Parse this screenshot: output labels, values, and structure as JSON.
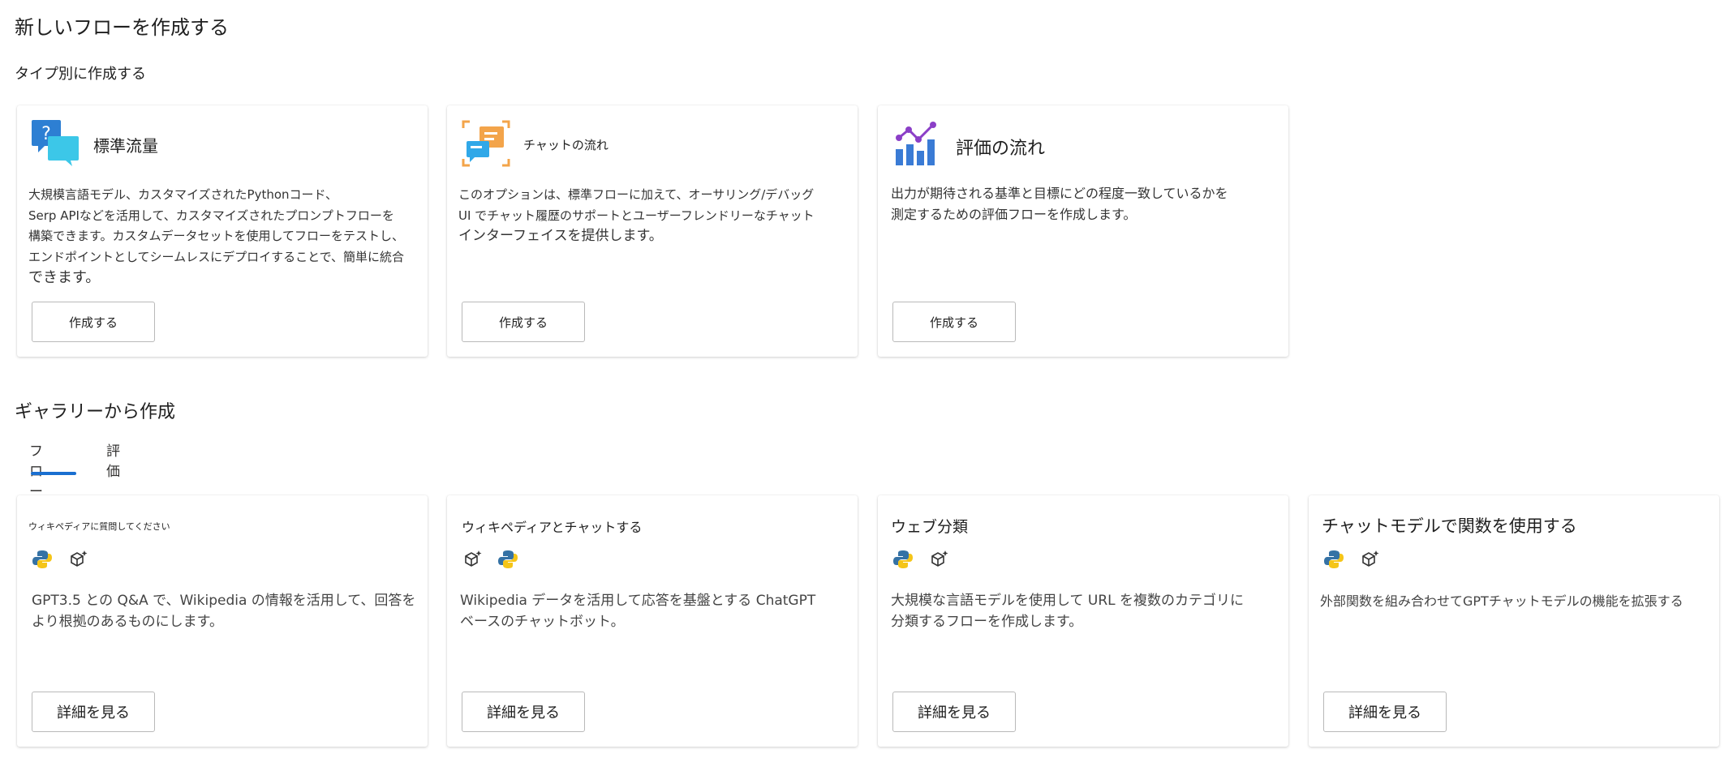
{
  "page": {
    "title": "新しいフローを作成する",
    "by_type_heading": "タイプ別に作成する",
    "gallery_heading": "ギャラリーから作成"
  },
  "type_cards": [
    {
      "title": "標準流量",
      "icon": "chat-question-icon",
      "desc_lines": [
        "大規模言語モデル、カスタマイズされたPythonコード、",
        " Serp APIなどを活用して、カスタマイズされたプロンプトフローを",
        "構築できます。カスタムデータセットを使用してフローをテストし、",
        "エンドポイントとしてシームレスにデプロイすることで、簡単に統合",
        "できます。"
      ],
      "button": "作成する"
    },
    {
      "title": "チャットの流れ",
      "icon": "chat-flow-icon",
      "desc_lines": [
        "このオプションは、標準フローに加えて、オーサリング/デバッグ",
        "UI でチャット履歴のサポートとユーザーフレンドリーなチャット",
        "インターフェイスを提供します。"
      ],
      "button": "作成する"
    },
    {
      "title": "評価の流れ",
      "icon": "evaluation-chart-icon",
      "desc_lines": [
        "出力が期待される基準と目標にどの程度一致しているかを",
        "測定するための評価フローを作成します。"
      ],
      "button": "作成する"
    }
  ],
  "tabs": [
    {
      "label": "フロー",
      "selected": true
    },
    {
      "label": "評価",
      "selected": false
    }
  ],
  "gallery_cards": [
    {
      "title": "ウィキペディアに質問してください",
      "chips": [
        "python-icon",
        "openai-icon"
      ],
      "desc_lines": [
        "GPT3.5 との Q&A で、Wikipedia の情報を活用して、回答を",
        "より根拠のあるものにします。"
      ],
      "button": "詳細を見る"
    },
    {
      "title": "ウィキペディアとチャットする",
      "chips": [
        "openai-icon",
        "python-icon"
      ],
      "desc_lines": [
        "Wikipedia データを活用して応答を基盤とする ChatGPT",
        "ベースのチャットボット。"
      ],
      "button": "詳細を見る"
    },
    {
      "title": "ウェブ分類",
      "chips": [
        "python-icon",
        "openai-icon"
      ],
      "desc_lines": [
        "大規模な言語モデルを使用して URL を複数のカテゴリに",
        "分類するフローを作成します。"
      ],
      "button": "詳細を見る"
    },
    {
      "title": "チャットモデルで関数を使用する",
      "chips": [
        "python-icon",
        "openai-icon"
      ],
      "desc_lines": [
        "外部関数を組み合わせてGPTチャットモデルの機能を拡張する"
      ],
      "button": "詳細を見る"
    }
  ],
  "colors": {
    "accent": "#1a6fd0",
    "python_blue": "#3572a5",
    "python_yellow": "#f5c518",
    "chart_purple": "#8b3fc7",
    "chat_orange": "#f3a44a",
    "chat_blue": "#30a8e8"
  }
}
